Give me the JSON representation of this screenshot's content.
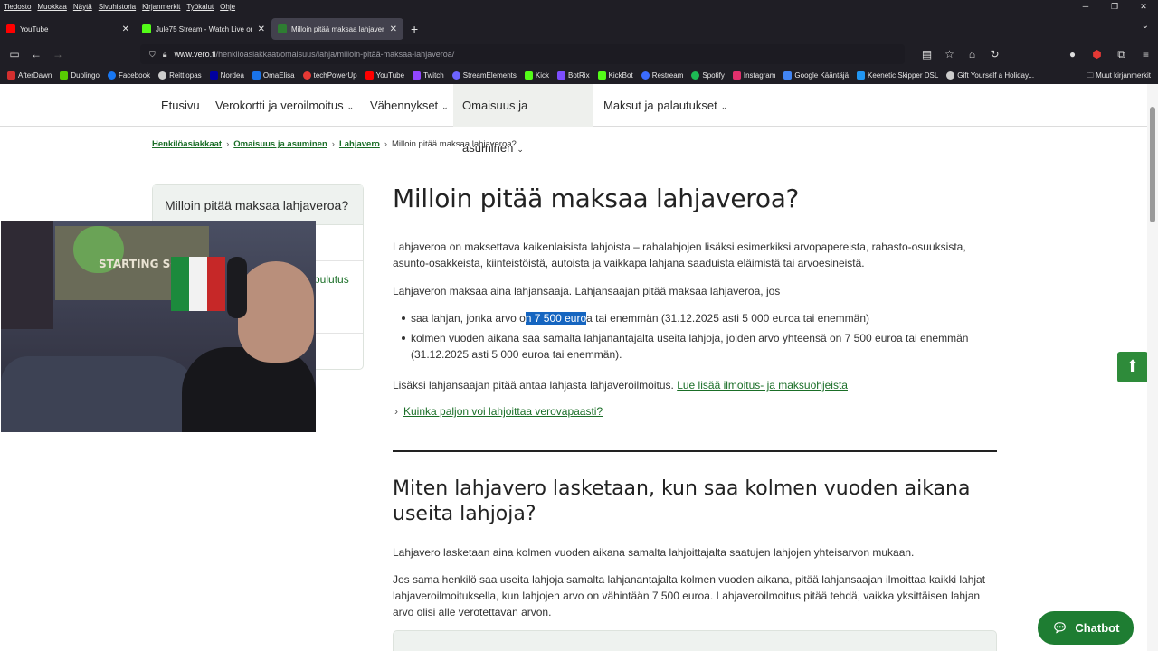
{
  "browser": {
    "menu": [
      "Tiedosto",
      "Muokkaa",
      "Näytä",
      "Sivuhistoria",
      "Kirjanmerkit",
      "Työkalut",
      "Ohje"
    ],
    "tabs": [
      {
        "title": "YouTube",
        "color": "#ff0000"
      },
      {
        "title": "Jule75 Stream - Watch Live on I",
        "color": "#53fc18"
      },
      {
        "title": "Milloin pitää maksaa lahjavero",
        "color": "#2e7d32"
      }
    ],
    "url_host": "www.vero.fi",
    "url_path": "/henkiloasiakkaat/omaisuus/lahja/milloin-pitää-maksaa-lahjaveroa/",
    "bookmarks": [
      {
        "label": "AfterDawn",
        "color": "#d32f2f"
      },
      {
        "label": "Duolingo",
        "color": "#58cc02"
      },
      {
        "label": "Facebook",
        "color": "#1877f2"
      },
      {
        "label": "Reittiopas",
        "color": "#cccccc"
      },
      {
        "label": "Nordea",
        "color": "#0000a0"
      },
      {
        "label": "OmaElisa",
        "color": "#1a73e8"
      },
      {
        "label": "techPowerUp",
        "color": "#e53935"
      },
      {
        "label": "YouTube",
        "color": "#ff0000"
      },
      {
        "label": "Twitch",
        "color": "#9146ff"
      },
      {
        "label": "StreamElements",
        "color": "#6c63ff"
      },
      {
        "label": "Kick",
        "color": "#53fc18"
      },
      {
        "label": "BotRix",
        "color": "#7c4dff"
      },
      {
        "label": "KickBot",
        "color": "#53fc18"
      },
      {
        "label": "Restream",
        "color": "#3b6cff"
      },
      {
        "label": "Spotify",
        "color": "#1db954"
      },
      {
        "label": "Instagram",
        "color": "#e1306c"
      },
      {
        "label": "Google Kääntäjä",
        "color": "#4285f4"
      },
      {
        "label": "Keenetic Skipper DSL",
        "color": "#2196f3"
      },
      {
        "label": "Gift Yourself a Holiday...",
        "color": "#cccccc"
      }
    ],
    "other_bookmarks": "Muut kirjanmerkit"
  },
  "topnav": {
    "home": "Etusivu",
    "items": [
      "Verokortti ja veroilmoitus",
      "Vähennykset",
      "Omaisuus ja asuminen",
      "Maksut ja palautukset"
    ]
  },
  "breadcrumb": {
    "items": [
      "Henkilöasiakkaat",
      "Omaisuus ja asuminen",
      "Lahjavero"
    ],
    "current": "Milloin pitää maksaa lahjaveroa?"
  },
  "sidebar": {
    "heading": "Milloin pitää maksaa lahjaveroa?",
    "visible_fragment": "pulutus"
  },
  "webcam": {
    "poster_text": "STARTING SOON"
  },
  "main": {
    "title": "Milloin pitää maksaa lahjaveroa?",
    "intro": "Lahjaveroa on maksettava kaikenlaisista lahjoista – rahalahjojen lisäksi esimerkiksi arvopapereista, rahasto-osuuksista, asunto-osakkeista, kiinteistöistä, autoista ja vaikkapa lahjana saaduista eläimistä tai arvoesineistä.",
    "payer": "Lahjaveron maksaa aina lahjansaaja. Lahjansaajan pitää maksaa lahjaveroa, jos",
    "bullet1_pre": "saa lahjan, jonka arvo o",
    "bullet1_hl": "n 7 500 euro",
    "bullet1_post": "a tai enemmän (31.12.2025 asti 5 000 euroa tai enemmän)",
    "bullet2": "kolmen vuoden aikana saa samalta lahjanantajalta useita lahjoja, joiden arvo yhteensä on 7 500 euroa tai enemmän (31.12.2025 asti 5 000 euroa tai enemmän).",
    "also": "Lisäksi lahjansaajan pitää antaa lahjasta lahjaveroilmoitus.",
    "also_link": "Lue lisää ilmoitus- ja maksuohjeista",
    "expand_link": "Kuinka paljon voi lahjoittaa verovapaasti?",
    "subtitle": "Miten lahjavero lasketaan, kun saa kolmen vuoden aikana useita lahjoja?",
    "calc_para1": "Lahjavero lasketaan aina kolmen vuoden aikana samalta lahjoittajalta saatujen lahjojen yhteisarvon mukaan.",
    "calc_para2": "Jos sama henkilö saa useita lahjoja samalta lahjanantajalta kolmen vuoden aikana, pitää lahjansaajan ilmoittaa kaikki lahjat lahjaveroilmoituksella, kun lahjojen arvo on vähintään 7 500 euroa. Lahjaveroilmoitus pitää tehdä, vaikka yksittäisen lahjan arvo olisi alle verotettavan arvon."
  },
  "chatbot_label": "Chatbot"
}
